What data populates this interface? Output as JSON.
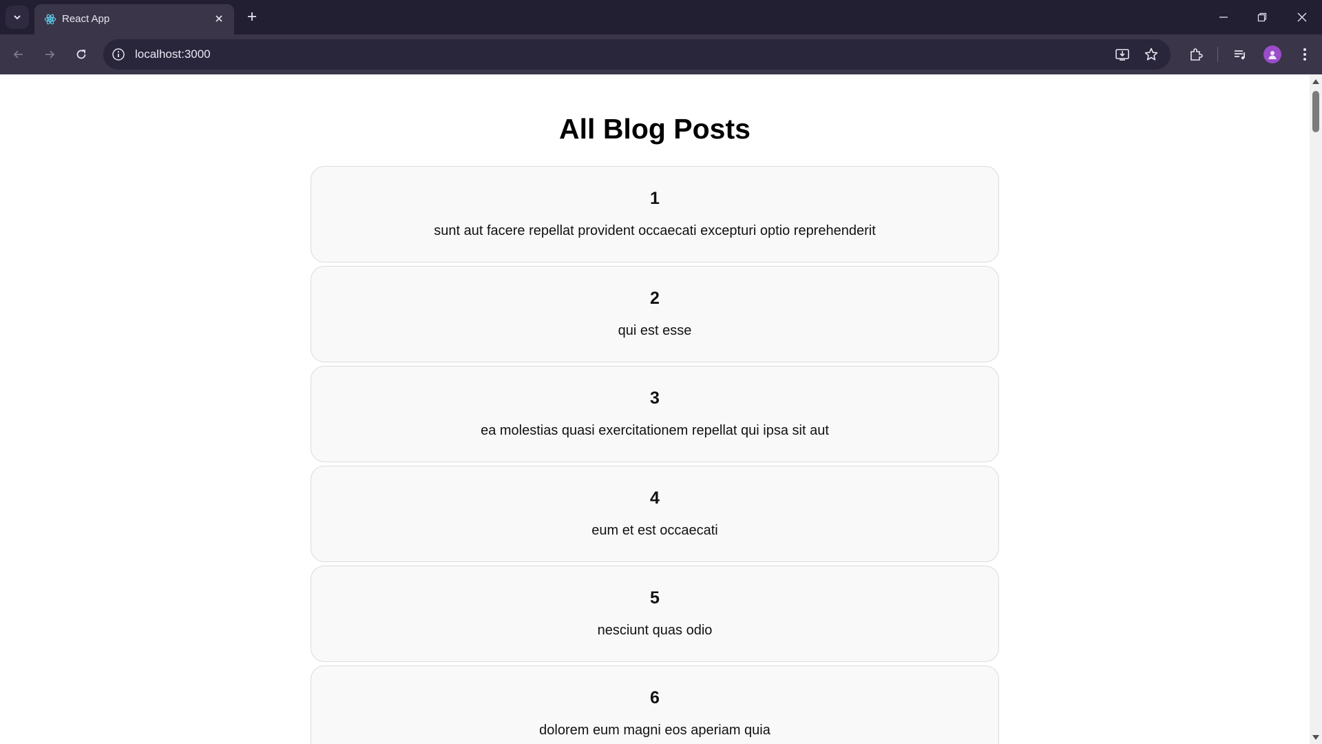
{
  "browser": {
    "tab_title": "React App",
    "url": "localhost:3000"
  },
  "page": {
    "heading": "All Blog Posts",
    "posts": [
      {
        "id": "1",
        "title": "sunt aut facere repellat provident occaecati excepturi optio reprehenderit"
      },
      {
        "id": "2",
        "title": "qui est esse"
      },
      {
        "id": "3",
        "title": "ea molestias quasi exercitationem repellat qui ipsa sit aut"
      },
      {
        "id": "4",
        "title": "eum et est occaecati"
      },
      {
        "id": "5",
        "title": "nesciunt quas odio"
      },
      {
        "id": "6",
        "title": "dolorem eum magni eos aperiam quia"
      }
    ]
  },
  "icons": {
    "tab_search": "chevron-down-icon",
    "favicon": "react-icon",
    "tab_close": "close-icon",
    "new_tab": "plus-icon",
    "minimize": "minimize-icon",
    "restore": "restore-icon",
    "close_window": "close-icon",
    "back": "arrow-left-icon",
    "forward": "arrow-right-icon",
    "reload": "reload-icon",
    "site_info": "info-icon",
    "install": "install-icon",
    "bookmark": "star-icon",
    "extensions": "puzzle-icon",
    "media": "media-controls-icon",
    "profile": "avatar",
    "menu": "kebab-menu-icon"
  }
}
